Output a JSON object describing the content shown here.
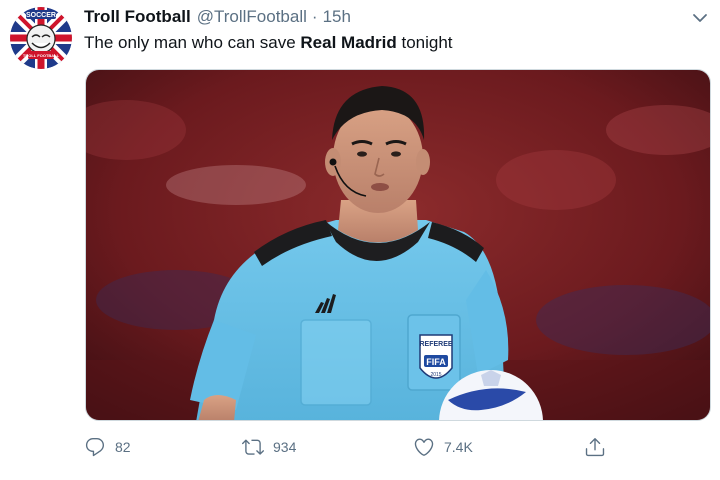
{
  "tweet": {
    "avatar": {
      "icon": "troll-face-union-jack-avatar",
      "badge_text": "SOCCER",
      "ring_text": "TROLL FOOTBALL"
    },
    "author_name": "Troll Football",
    "author_handle": "@TrollFootball",
    "separator": "·",
    "time": "15h",
    "text_before": "The only man who can save ",
    "text_bold": "Real Madrid",
    "text_after": " tonight",
    "media": {
      "description_icon": "referee-photo",
      "badge_line1": "REFEREE",
      "badge_line2": "FIFA",
      "badge_year": "2015",
      "shirt_brand": "adidas"
    },
    "actions": {
      "reply": {
        "icon": "reply-icon",
        "count": "82"
      },
      "retweet": {
        "icon": "retweet-icon",
        "count": "934"
      },
      "like": {
        "icon": "heart-icon",
        "count": "7.4K"
      },
      "share": {
        "icon": "share-icon"
      }
    }
  },
  "colors": {
    "text": "#0f1419",
    "secondary": "#5b7083",
    "shirt": "#6ec3e8",
    "background_red": "#7a1c1f"
  }
}
